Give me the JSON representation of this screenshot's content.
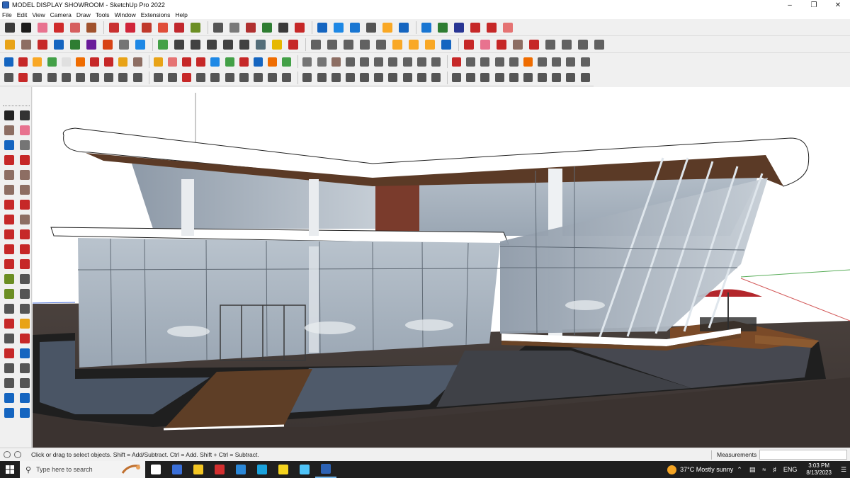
{
  "window": {
    "title": "MODEL DISPLAY SHOWROOM - SketchUp Pro 2022",
    "minimize_icon": "minimize-icon",
    "maximize_icon": "restore-icon",
    "close_icon": "close-icon"
  },
  "menu": [
    "File",
    "Edit",
    "View",
    "Camera",
    "Draw",
    "Tools",
    "Window",
    "Extensions",
    "Help"
  ],
  "toolbars": {
    "row1": [
      {
        "name": "zoom-tool",
        "color": "#3a3a3a"
      },
      {
        "name": "select-tool",
        "color": "#1b1b1b"
      },
      {
        "name": "eraser-tool",
        "color": "#e8728f"
      },
      {
        "name": "pencil-tool",
        "color": "#cf2b2b"
      },
      {
        "name": "lasso-tool",
        "color": "#d65f5f"
      },
      {
        "name": "paint-bucket-tool",
        "color": "#a0522d"
      },
      {
        "name": "push-pull-tool",
        "color": "#c93030"
      },
      {
        "name": "move-tool",
        "color": "#d0253a"
      },
      {
        "name": "rotate-tool",
        "color": "#c0392b"
      },
      {
        "name": "scale-tool",
        "color": "#e04e39"
      },
      {
        "name": "offset-tool",
        "color": "#c1272d"
      },
      {
        "name": "tape-measure-tool",
        "color": "#6b8e23"
      },
      {
        "name": "text-tool",
        "color": "#555555"
      },
      {
        "name": "dimension-tool",
        "color": "#7a7a7a"
      },
      {
        "name": "orbit-tool",
        "color": "#b03030"
      },
      {
        "name": "pan-tool",
        "color": "#2e7d32"
      },
      {
        "name": "zoom-window-tool",
        "color": "#3a3a3a"
      },
      {
        "name": "zoom-extents-tool",
        "color": "#c62828"
      },
      {
        "name": "section-plane-tool",
        "color": "#1565c0"
      },
      {
        "name": "section-cut-tool",
        "color": "#1e88e5"
      },
      {
        "name": "display-section-tool",
        "color": "#1976d2"
      },
      {
        "name": "account-icon",
        "color": "#555555"
      },
      {
        "name": "3d-warehouse-icon",
        "color": "#f9a825"
      },
      {
        "name": "extension-warehouse-icon",
        "color": "#1565c0"
      },
      {
        "name": "component-icon",
        "color": "#1976d2"
      },
      {
        "name": "sandbox-icon",
        "color": "#2e7d32"
      },
      {
        "name": "axes-tool",
        "color": "#283593"
      },
      {
        "name": "undo-icon",
        "color": "#c62828"
      },
      {
        "name": "redo-icon",
        "color": "#c62828"
      },
      {
        "name": "layers-icon",
        "color": "#e57373"
      }
    ],
    "row2": [
      {
        "name": "materials-icon",
        "color": "#e8a317"
      },
      {
        "name": "iso-view-icon",
        "color": "#8d6e63"
      },
      {
        "name": "top-view-icon",
        "color": "#c62828"
      },
      {
        "name": "front-view-icon",
        "color": "#1565c0"
      },
      {
        "name": "right-view-icon",
        "color": "#2e7d32"
      },
      {
        "name": "back-view-icon",
        "color": "#6a1b9a"
      },
      {
        "name": "left-view-icon",
        "color": "#d84315"
      },
      {
        "name": "camera-position-icon",
        "color": "#757575"
      },
      {
        "name": "xray-icon",
        "color": "#1e88e5"
      },
      {
        "name": "wireframe-icon",
        "color": "#43a047"
      },
      {
        "name": "hidden-line-icon",
        "color": "#424242"
      },
      {
        "name": "shaded-icon",
        "color": "#424242"
      },
      {
        "name": "textured-icon",
        "color": "#424242"
      },
      {
        "name": "monochrome-icon",
        "color": "#424242"
      },
      {
        "name": "house-icon",
        "color": "#424242"
      },
      {
        "name": "component-options-icon",
        "color": "#546e7a"
      },
      {
        "name": "scenes-icon",
        "color": "#e6b800"
      },
      {
        "name": "paint-icon",
        "color": "#c62828"
      },
      {
        "name": "curve-icon",
        "color": "#616161"
      },
      {
        "name": "arc-icon",
        "color": "#616161"
      },
      {
        "name": "circle-icon",
        "color": "#616161"
      },
      {
        "name": "polygon-icon",
        "color": "#616161"
      },
      {
        "name": "freehand-icon",
        "color": "#616161"
      },
      {
        "name": "grid-icon",
        "color": "#f9a825"
      },
      {
        "name": "weld-icon",
        "color": "#f9a825"
      },
      {
        "name": "soften-icon",
        "color": "#f9a825"
      },
      {
        "name": "explode-icon",
        "color": "#1565c0"
      },
      {
        "name": "measure-icon",
        "color": "#c62828"
      },
      {
        "name": "label-icon",
        "color": "#e8728f"
      },
      {
        "name": "cut-icon",
        "color": "#c62828"
      },
      {
        "name": "layer-manager-icon",
        "color": "#8d6e63"
      },
      {
        "name": "trim-icon",
        "color": "#c62828"
      },
      {
        "name": "extend-icon",
        "color": "#616161"
      },
      {
        "name": "join-icon",
        "color": "#616161"
      },
      {
        "name": "intersect-icon",
        "color": "#616161"
      },
      {
        "name": "subtract-icon",
        "color": "#616161"
      }
    ],
    "row3": [
      {
        "name": "solid-tools-icon",
        "color": "#1565c0"
      },
      {
        "name": "follow-me-icon",
        "color": "#c62828"
      },
      {
        "name": "fillet-icon",
        "color": "#f9a825"
      },
      {
        "name": "chamfer-icon",
        "color": "#43a047"
      },
      {
        "name": "bevel-icon",
        "color": "#e0e0e0"
      },
      {
        "name": "round-corner-icon",
        "color": "#ef6c00"
      },
      {
        "name": "shell-icon",
        "color": "#c62828"
      },
      {
        "name": "split-icon",
        "color": "#c62828"
      },
      {
        "name": "hide-icon",
        "color": "#e8a317"
      },
      {
        "name": "lock-icon",
        "color": "#8d6e63"
      },
      {
        "name": "unlock-icon",
        "color": "#e8a317"
      },
      {
        "name": "erase-all-icon",
        "color": "#e57373"
      },
      {
        "name": "flip-icon",
        "color": "#c62828"
      },
      {
        "name": "mirror-icon",
        "color": "#c62828"
      },
      {
        "name": "array-icon",
        "color": "#1e88e5"
      },
      {
        "name": "pattern-icon",
        "color": "#43a047"
      },
      {
        "name": "align-icon",
        "color": "#c62828"
      },
      {
        "name": "distribute-icon",
        "color": "#1565c0"
      },
      {
        "name": "cone-icon",
        "color": "#ef6c00"
      },
      {
        "name": "pyramid-icon",
        "color": "#43a047"
      },
      {
        "name": "sphere-icon",
        "color": "#757575"
      },
      {
        "name": "cylinder-icon",
        "color": "#757575"
      },
      {
        "name": "box-icon",
        "color": "#8d6e63"
      },
      {
        "name": "torus-icon",
        "color": "#616161"
      },
      {
        "name": "stairs-icon",
        "color": "#616161"
      },
      {
        "name": "roof-icon",
        "color": "#616161"
      },
      {
        "name": "wall-icon",
        "color": "#616161"
      },
      {
        "name": "window-icon",
        "color": "#616161"
      },
      {
        "name": "door-icon",
        "color": "#616161"
      },
      {
        "name": "railing-icon",
        "color": "#616161"
      },
      {
        "name": "column-icon",
        "color": "#c62828"
      },
      {
        "name": "beam-icon",
        "color": "#616161"
      },
      {
        "name": "slab-icon",
        "color": "#616161"
      },
      {
        "name": "hatch-icon",
        "color": "#616161"
      },
      {
        "name": "profile-icon",
        "color": "#616161"
      },
      {
        "name": "texture-icon",
        "color": "#ef6c00"
      },
      {
        "name": "uv-map-icon",
        "color": "#616161"
      },
      {
        "name": "grid-panel-icon",
        "color": "#616161"
      },
      {
        "name": "tile-icon",
        "color": "#616161"
      },
      {
        "name": "spring-icon",
        "color": "#616161"
      }
    ],
    "row4": [
      {
        "name": "draw-line-icon",
        "color": "#555555"
      },
      {
        "name": "dash-line-icon",
        "color": "#c62828"
      },
      {
        "name": "dot-line-icon",
        "color": "#555555"
      },
      {
        "name": "knife-icon",
        "color": "#555555"
      },
      {
        "name": "bend-icon",
        "color": "#555555"
      },
      {
        "name": "twist-icon",
        "color": "#555555"
      },
      {
        "name": "taper-icon",
        "color": "#555555"
      },
      {
        "name": "warp-icon",
        "color": "#555555"
      },
      {
        "name": "loft-icon",
        "color": "#555555"
      },
      {
        "name": "skin-icon",
        "color": "#555555"
      },
      {
        "name": "curve-loft-icon",
        "color": "#555555"
      },
      {
        "name": "spline-icon",
        "color": "#555555"
      },
      {
        "name": "bezier-icon",
        "color": "#c62828"
      },
      {
        "name": "polyline-icon",
        "color": "#555555"
      },
      {
        "name": "offset-edge-icon",
        "color": "#555555"
      },
      {
        "name": "edge-tools-icon",
        "color": "#555555"
      },
      {
        "name": "cleanup-icon",
        "color": "#555555"
      },
      {
        "name": "weld-edge-icon",
        "color": "#555555"
      },
      {
        "name": "divide-icon",
        "color": "#555555"
      },
      {
        "name": "subdivide-icon",
        "color": "#555555"
      },
      {
        "name": "smooth-icon",
        "color": "#555555"
      },
      {
        "name": "crease-icon",
        "color": "#555555"
      },
      {
        "name": "relax-icon",
        "color": "#555555"
      },
      {
        "name": "inflate-icon",
        "color": "#555555"
      },
      {
        "name": "shape-bender-icon",
        "color": "#555555"
      },
      {
        "name": "flowify-icon",
        "color": "#555555"
      },
      {
        "name": "extrude-icon",
        "color": "#555555"
      },
      {
        "name": "extrude-line-icon",
        "color": "#555555"
      },
      {
        "name": "extrude-edge-icon",
        "color": "#555555"
      },
      {
        "name": "extrude-face-icon",
        "color": "#555555"
      },
      {
        "name": "extrude-along-icon",
        "color": "#555555"
      },
      {
        "name": "joint-push-pull-icon",
        "color": "#555555"
      },
      {
        "name": "vector-push-pull-icon",
        "color": "#555555"
      },
      {
        "name": "normal-push-pull-icon",
        "color": "#555555"
      },
      {
        "name": "round-edge-icon",
        "color": "#555555"
      },
      {
        "name": "shell-tool-icon",
        "color": "#555555"
      },
      {
        "name": "fur-icon",
        "color": "#555555"
      },
      {
        "name": "vertex-icon",
        "color": "#555555"
      },
      {
        "name": "cloth-icon",
        "color": "#555555"
      },
      {
        "name": "hex-icon",
        "color": "#555555"
      }
    ],
    "left": [
      {
        "name": "select-tool",
        "color": "#222222"
      },
      {
        "name": "lasso-select-tool",
        "color": "#333333"
      },
      {
        "name": "paint-bucket-tool",
        "color": "#8d6e63"
      },
      {
        "name": "eraser-tool",
        "color": "#e8728f"
      },
      {
        "name": "make-component-tool",
        "color": "#1565c0"
      },
      {
        "name": "pencil-tool",
        "color": "#757575"
      },
      {
        "name": "line-tool",
        "color": "#c62828"
      },
      {
        "name": "freehand-tool",
        "color": "#c62828"
      },
      {
        "name": "rectangle-tool",
        "color": "#8d6e63"
      },
      {
        "name": "rotated-rectangle-tool",
        "color": "#8d6e63"
      },
      {
        "name": "circle-tool",
        "color": "#8d6e63"
      },
      {
        "name": "polygon-tool",
        "color": "#8d6e63"
      },
      {
        "name": "arc-tool",
        "color": "#c62828"
      },
      {
        "name": "two-point-arc-tool",
        "color": "#c62828"
      },
      {
        "name": "three-point-arc-tool",
        "color": "#c62828"
      },
      {
        "name": "pie-tool",
        "color": "#8d6e63"
      },
      {
        "name": "move-tool",
        "color": "#c62828"
      },
      {
        "name": "push-pull-tool",
        "color": "#c62828"
      },
      {
        "name": "rotate-tool",
        "color": "#c62828"
      },
      {
        "name": "follow-me-tool",
        "color": "#c62828"
      },
      {
        "name": "scale-tool",
        "color": "#c62828"
      },
      {
        "name": "offset-tool",
        "color": "#c62828"
      },
      {
        "name": "tape-measure-tool",
        "color": "#6b8e23"
      },
      {
        "name": "dimension-tool",
        "color": "#555555"
      },
      {
        "name": "protractor-tool",
        "color": "#6b8e23"
      },
      {
        "name": "text-tool",
        "color": "#555555"
      },
      {
        "name": "axes-tool",
        "color": "#555555"
      },
      {
        "name": "3d-text-tool",
        "color": "#555555"
      },
      {
        "name": "orbit-tool",
        "color": "#c62828"
      },
      {
        "name": "pan-tool",
        "color": "#e8a317"
      },
      {
        "name": "zoom-tool",
        "color": "#555555"
      },
      {
        "name": "zoom-window-tool",
        "color": "#c62828"
      },
      {
        "name": "zoom-extents-tool",
        "color": "#c62828"
      },
      {
        "name": "previous-view-tool",
        "color": "#1565c0"
      },
      {
        "name": "position-camera-tool",
        "color": "#555555"
      },
      {
        "name": "look-around-tool",
        "color": "#555555"
      },
      {
        "name": "walk-tool",
        "color": "#555555"
      },
      {
        "name": "section-plane-tool",
        "color": "#555555"
      },
      {
        "name": "section-fill-tool",
        "color": "#1565c0"
      },
      {
        "name": "display-sections-tool",
        "color": "#1565c0"
      },
      {
        "name": "section-cuts-tool",
        "color": "#1565c0"
      },
      {
        "name": "section-planes-tool",
        "color": "#1565c0"
      }
    ]
  },
  "status": {
    "hint": "Click or drag to select objects. Shift = Add/Subtract. Ctrl = Add. Shift + Ctrl = Subtract.",
    "measurements_label": "Measurements",
    "measurements_value": ""
  },
  "taskbar": {
    "search_placeholder": "Type here to search",
    "apps": [
      {
        "name": "task-view-icon",
        "color": "#ffffff"
      },
      {
        "name": "calculator-icon",
        "color": "#3a6fd8"
      },
      {
        "name": "file-explorer-icon",
        "color": "#f3c623"
      },
      {
        "name": "acrobat-icon",
        "color": "#d32f2f"
      },
      {
        "name": "photos-icon",
        "color": "#2b88d8"
      },
      {
        "name": "edge-icon",
        "color": "#1aa2dc"
      },
      {
        "name": "sticky-notes-icon",
        "color": "#f4d31e"
      },
      {
        "name": "notepad-icon",
        "color": "#4fc3f7"
      },
      {
        "name": "sketchup-icon",
        "color": "#2d63b5"
      }
    ],
    "weather": "37°C  Mostly sunny",
    "language": "ENG",
    "time": "3:03 PM",
    "date": "8/13/2023"
  }
}
